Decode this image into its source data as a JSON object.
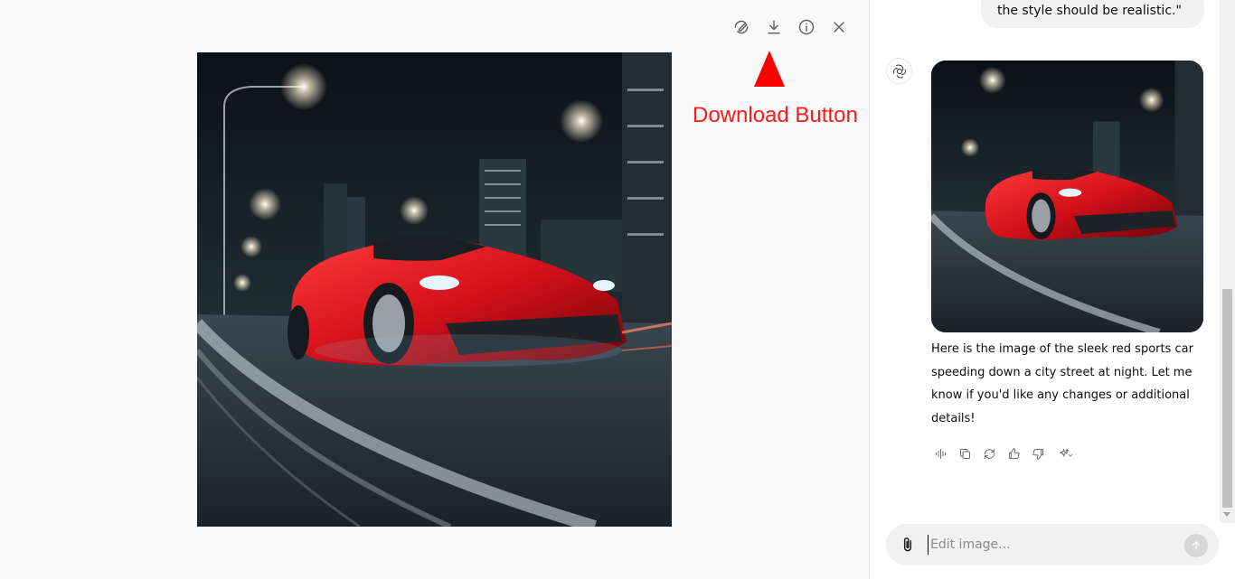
{
  "viewer": {
    "toolbar": {
      "edit_icon": "edit-brush-icon",
      "download_icon": "download-icon",
      "info_icon": "info-icon",
      "close_icon": "close-icon"
    },
    "annotation": {
      "label": "Download Button",
      "color": "#ff0000"
    }
  },
  "chat": {
    "user_message_tail": "the style should be realistic.\"",
    "assistant_text": "Here is the image of the sleek red sports car speeding down a city street at night. Let me know if you'd like any changes or additional details!",
    "actions": [
      "read-aloud-icon",
      "copy-icon",
      "regenerate-icon",
      "thumbs-up-icon",
      "thumbs-down-icon",
      "sparkle-model-icon"
    ],
    "composer": {
      "placeholder": "Edit image...",
      "value": ""
    }
  }
}
